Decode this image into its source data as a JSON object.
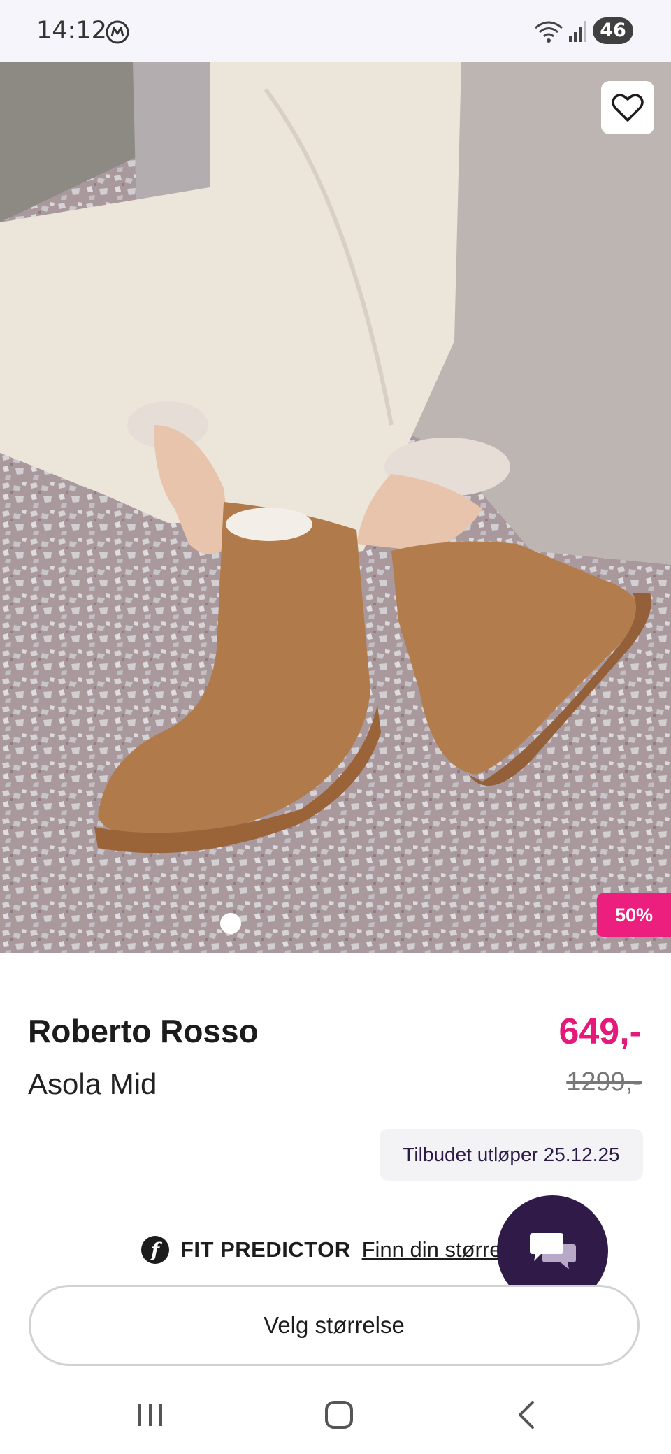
{
  "status_bar": {
    "time": "14:12",
    "battery": "46",
    "icons": [
      "m-app-icon",
      "wifi-icon",
      "signal-icon",
      "battery-icon"
    ]
  },
  "hero": {
    "discount_badge": "50%",
    "carousel_dots": 1,
    "favorite_icon": "heart-outline-icon"
  },
  "product": {
    "brand": "Roberto Rosso",
    "model": "Asola Mid",
    "price": "649,-",
    "old_price": "1299,-",
    "offer_text": "Tilbudet utløper 25.12.25",
    "accent_color": "#e5197a"
  },
  "fit_predictor": {
    "logo": "f",
    "title": "FIT PREDICTOR",
    "link": "Finn din størrelse"
  },
  "size_button": {
    "label": "Velg størrelse"
  },
  "chat": {
    "icon": "chat-bubbles-icon",
    "color": "#2f1a48"
  },
  "nav": {
    "icons": [
      "recent-apps-icon",
      "home-icon",
      "back-icon"
    ]
  }
}
